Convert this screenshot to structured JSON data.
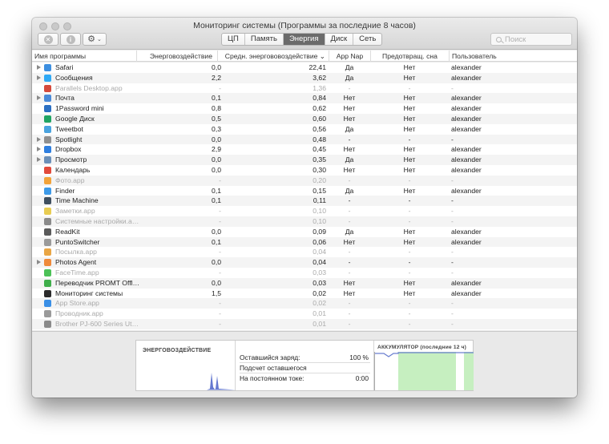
{
  "window": {
    "title": "Мониторинг системы (Программы за последние 8 часов)"
  },
  "toolbar": {
    "tabs": [
      {
        "label": "ЦП"
      },
      {
        "label": "Память"
      },
      {
        "label": "Энергия"
      },
      {
        "label": "Диск"
      },
      {
        "label": "Сеть"
      }
    ],
    "active_tab": "Энергия",
    "search_placeholder": "Поиск",
    "close_glyph": "✕",
    "info_glyph": "i",
    "gear_glyph": "⚙",
    "chevron_glyph": "⌄"
  },
  "table": {
    "columns": [
      "Имя программы",
      "Энерговоздействие",
      "Средн. энергововоздействие ⌄",
      "App Nap",
      "Предотвращ. сна",
      "Пользователь"
    ],
    "rows": [
      {
        "name": "Safari",
        "impact": "0,0",
        "avg": "22,41",
        "nap": "Да",
        "sleep": "Нет",
        "user": "alexander",
        "disclosure": true,
        "dim": false,
        "icon": "safari-icon",
        "color": "#3d8fe0"
      },
      {
        "name": "Сообщения",
        "impact": "2,2",
        "avg": "3,62",
        "nap": "Да",
        "sleep": "Нет",
        "user": "alexander",
        "disclosure": true,
        "dim": false,
        "icon": "messages-icon",
        "color": "#2fa9f5"
      },
      {
        "name": "Parallels Desktop.app",
        "impact": "-",
        "avg": "1,36",
        "nap": "-",
        "sleep": "-",
        "user": "-",
        "disclosure": false,
        "dim": true,
        "icon": "parallels-icon",
        "color": "#d54a3c"
      },
      {
        "name": "Почта",
        "impact": "0,1",
        "avg": "0,84",
        "nap": "Нет",
        "sleep": "Нет",
        "user": "alexander",
        "disclosure": true,
        "dim": false,
        "icon": "mail-icon",
        "color": "#4a8ad8"
      },
      {
        "name": "1Password mini",
        "impact": "0,8",
        "avg": "0,62",
        "nap": "Нет",
        "sleep": "Нет",
        "user": "alexander",
        "disclosure": false,
        "dim": false,
        "icon": "onepassword-icon",
        "color": "#2b6fc2"
      },
      {
        "name": "Google Диск",
        "impact": "0,5",
        "avg": "0,60",
        "nap": "Нет",
        "sleep": "Нет",
        "user": "alexander",
        "disclosure": false,
        "dim": false,
        "icon": "google-drive-icon",
        "color": "#1fa463"
      },
      {
        "name": "Tweetbot",
        "impact": "0,3",
        "avg": "0,56",
        "nap": "Да",
        "sleep": "Нет",
        "user": "alexander",
        "disclosure": false,
        "dim": false,
        "icon": "tweetbot-icon",
        "color": "#4aa3df"
      },
      {
        "name": "Spotlight",
        "impact": "0,0",
        "avg": "0,48",
        "nap": "-",
        "sleep": "-",
        "user": "-",
        "disclosure": true,
        "dim": false,
        "icon": "spotlight-icon",
        "color": "#8f8f8f"
      },
      {
        "name": "Dropbox",
        "impact": "2,9",
        "avg": "0,45",
        "nap": "Нет",
        "sleep": "Нет",
        "user": "alexander",
        "disclosure": true,
        "dim": false,
        "icon": "dropbox-icon",
        "color": "#2f7fe0"
      },
      {
        "name": "Просмотр",
        "impact": "0,0",
        "avg": "0,35",
        "nap": "Да",
        "sleep": "Нет",
        "user": "alexander",
        "disclosure": true,
        "dim": false,
        "icon": "preview-icon",
        "color": "#6b8fb8"
      },
      {
        "name": "Календарь",
        "impact": "0,0",
        "avg": "0,30",
        "nap": "Нет",
        "sleep": "Нет",
        "user": "alexander",
        "disclosure": false,
        "dim": false,
        "icon": "calendar-icon",
        "color": "#e24a3b"
      },
      {
        "name": "Фото.app",
        "impact": "-",
        "avg": "0,20",
        "nap": "-",
        "sleep": "-",
        "user": "-",
        "disclosure": false,
        "dim": true,
        "icon": "photos-icon",
        "color": "#f2a33a"
      },
      {
        "name": "Finder",
        "impact": "0,1",
        "avg": "0,15",
        "nap": "Да",
        "sleep": "Нет",
        "user": "alexander",
        "disclosure": false,
        "dim": false,
        "icon": "finder-icon",
        "color": "#3d9ae8"
      },
      {
        "name": "Time Machine",
        "impact": "0,1",
        "avg": "0,11",
        "nap": "-",
        "sleep": "-",
        "user": "-",
        "disclosure": false,
        "dim": false,
        "icon": "time-machine-icon",
        "color": "#3f4f5f"
      },
      {
        "name": "Заметки.app",
        "impact": "-",
        "avg": "0,10",
        "nap": "-",
        "sleep": "-",
        "user": "-",
        "disclosure": false,
        "dim": true,
        "icon": "notes-icon",
        "color": "#e8cc52"
      },
      {
        "name": "Системные настройки.a…",
        "impact": "-",
        "avg": "0,10",
        "nap": "-",
        "sleep": "-",
        "user": "-",
        "disclosure": false,
        "dim": true,
        "icon": "system-preferences-icon",
        "color": "#8a8a8a"
      },
      {
        "name": "ReadKit",
        "impact": "0,0",
        "avg": "0,09",
        "nap": "Да",
        "sleep": "Нет",
        "user": "alexander",
        "disclosure": false,
        "dim": false,
        "icon": "readkit-icon",
        "color": "#5a5a5a"
      },
      {
        "name": "PuntoSwitcher",
        "impact": "0,1",
        "avg": "0,06",
        "nap": "Нет",
        "sleep": "Нет",
        "user": "alexander",
        "disclosure": false,
        "dim": false,
        "icon": "puntoswitcher-icon",
        "color": "#9a9a9a"
      },
      {
        "name": "Посылка.app",
        "impact": "-",
        "avg": "0,04",
        "nap": "-",
        "sleep": "-",
        "user": "-",
        "disclosure": false,
        "dim": true,
        "icon": "parcel-icon",
        "color": "#e9a645"
      },
      {
        "name": "Photos Agent",
        "impact": "0,0",
        "avg": "0,04",
        "nap": "-",
        "sleep": "-",
        "user": "-",
        "disclosure": true,
        "dim": false,
        "icon": "photos-agent-icon",
        "color": "#ef8a3a"
      },
      {
        "name": "FaceTime.app",
        "impact": "-",
        "avg": "0,03",
        "nap": "-",
        "sleep": "-",
        "user": "-",
        "disclosure": false,
        "dim": true,
        "icon": "facetime-icon",
        "color": "#4cc157"
      },
      {
        "name": "Переводчик PROMT Offl…",
        "impact": "0,0",
        "avg": "0,03",
        "nap": "Нет",
        "sleep": "Нет",
        "user": "alexander",
        "disclosure": false,
        "dim": false,
        "icon": "promt-icon",
        "color": "#3fae4a"
      },
      {
        "name": "Мониторинг системы",
        "impact": "1,5",
        "avg": "0,02",
        "nap": "Нет",
        "sleep": "Нет",
        "user": "alexander",
        "disclosure": false,
        "dim": false,
        "icon": "activity-monitor-icon",
        "color": "#2b2b2b"
      },
      {
        "name": "App Store.app",
        "impact": "-",
        "avg": "0,02",
        "nap": "-",
        "sleep": "-",
        "user": "-",
        "disclosure": false,
        "dim": true,
        "icon": "app-store-icon",
        "color": "#3a8fe6"
      },
      {
        "name": "Проводник.app",
        "impact": "-",
        "avg": "0,01",
        "nap": "-",
        "sleep": "-",
        "user": "-",
        "disclosure": false,
        "dim": true,
        "icon": "explorer-icon",
        "color": "#9a9a9a"
      },
      {
        "name": "Brother PJ-600 Series Ut…",
        "impact": "-",
        "avg": "0,01",
        "nap": "-",
        "sleep": "-",
        "user": "-",
        "disclosure": false,
        "dim": true,
        "icon": "printer-icon",
        "color": "#8a8a8a"
      }
    ]
  },
  "bottom": {
    "energy_label": "ЭНЕРГОВОЗДЕЙСТВИЕ",
    "stats": [
      {
        "label": "Оставшийся заряд:",
        "value": "100 %"
      },
      {
        "label": "Подсчет оставшегося",
        "value": ""
      },
      {
        "label": "На постоянном токе:",
        "value": "0:00"
      }
    ],
    "battery_label": "АККУМУЛЯТОР (последние 12 ч)",
    "battery_level": 1.0
  }
}
